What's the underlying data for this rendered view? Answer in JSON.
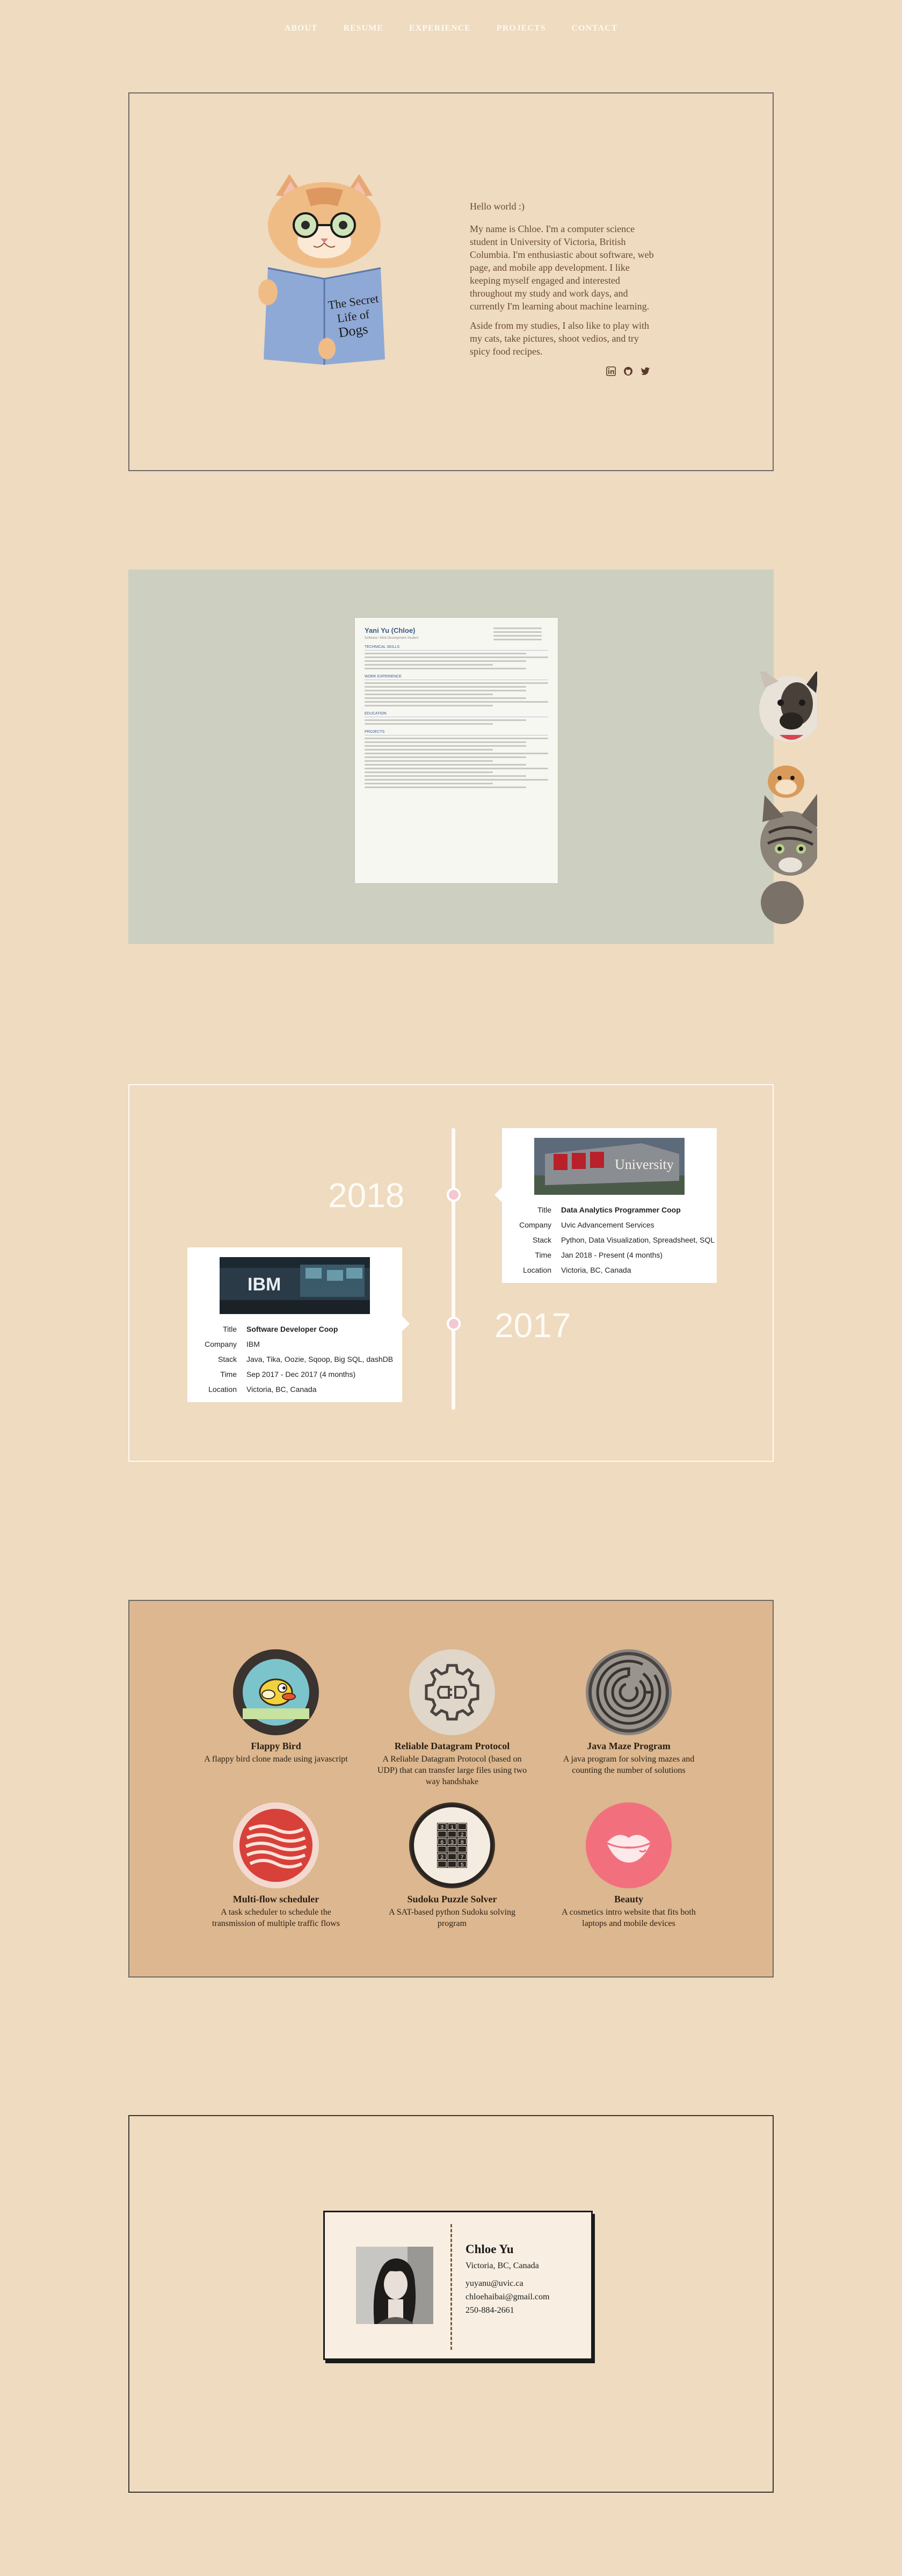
{
  "nav": {
    "items": [
      "ABOUT",
      "RESUME",
      "EXPERIENCE",
      "PROJECTS",
      "CONTACT"
    ]
  },
  "about": {
    "hello": "Hello world :)",
    "para1": "My name is Chloe. I'm a computer science student in University of Victoria, British Columbia. I'm enthusiastic about software, web page, and mobile app development. I like keeping myself engaged and interested throughout my study and work days, and currently I'm learning about machine learning.",
    "para2": "Aside from my studies, I also like to play with my cats, take pictures, shoot vedios, and try spicy food recipes.",
    "book_title": "The Secret Life of Dogs",
    "social_icons": [
      "linkedin-icon",
      "github-icon",
      "twitter-icon"
    ]
  },
  "resume": {
    "name": "Yani Yu (Chloe)",
    "subtitle": "Software / Web Development Student",
    "sections": [
      "TECHNICAL SKILLS",
      "WORK EXPERIENCE",
      "EDUCATION",
      "PROJECTS"
    ]
  },
  "experience": {
    "years": [
      "2018",
      "2017"
    ],
    "labels": {
      "title": "Title",
      "company": "Company",
      "stack": "Stack",
      "time": "Time",
      "location": "Location"
    },
    "jobs": [
      {
        "logo_text": "University",
        "title": "Data Analytics Programmer Coop",
        "company": "Uvic Advancement Services",
        "stack": "Python, Data Visualization, Spreadsheet, SQL",
        "time": "Jan 2018 - Present (4 months)",
        "location": "Victoria, BC, Canada"
      },
      {
        "logo_text": "IBM",
        "title": "Software Developer Coop",
        "company": "IBM",
        "stack": "Java, Tika, Oozie, Sqoop, Big SQL, dashDB",
        "time": "Sep 2017 - Dec 2017 (4 months)",
        "location": "Victoria, BC, Canada"
      }
    ]
  },
  "projects": {
    "items": [
      {
        "title": "Flappy Bird",
        "desc": "A flappy bird clone made using javascript",
        "icon": "flappy-bird-icon"
      },
      {
        "title": "Reliable Datagram Protocol",
        "desc": "A Reliable Datagram Protocol (based on UDP) that can transfer large files using two way handshake",
        "icon": "plug-gear-icon"
      },
      {
        "title": "Java Maze Program",
        "desc": "A java program for solving mazes and counting the number of solutions",
        "icon": "maze-icon"
      },
      {
        "title": "Multi-flow scheduler",
        "desc": "A task scheduler to schedule the transmission of multiple traffic flows",
        "icon": "wave-lines-icon"
      },
      {
        "title": "Sudoku Puzzle Solver",
        "desc": "A SAT-based python Sudoku solving program",
        "icon": "sudoku-grid-icon"
      },
      {
        "title": "Beauty",
        "desc": "A cosmetics intro website that fits both laptops and mobile devices",
        "icon": "lips-icon"
      }
    ],
    "sudoku_digits": [
      "3",
      "1",
      "",
      "",
      "",
      "2",
      "6",
      "3",
      "8",
      "",
      "",
      "",
      "2",
      "",
      "7",
      "",
      "",
      "5"
    ]
  },
  "contact": {
    "name": "Chloe Yu",
    "location": "Victoria, BC, Canada",
    "email1": "yuyanu@uvic.ca",
    "email2": "chloehaibai@gmail.com",
    "phone": "250-884-2661"
  }
}
